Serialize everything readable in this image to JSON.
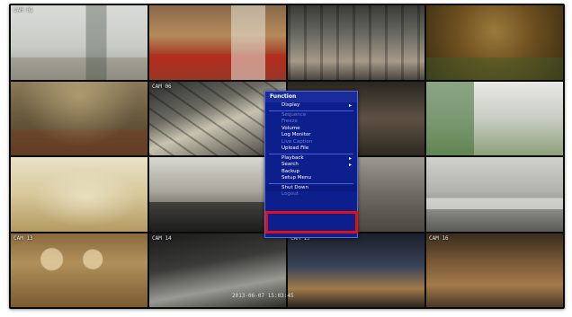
{
  "cameras": [
    {
      "label": "CAM 01"
    },
    {
      "label": ""
    },
    {
      "label": ""
    },
    {
      "label": ""
    },
    {
      "label": ""
    },
    {
      "label": "CAM 06"
    },
    {
      "label": ""
    },
    {
      "label": ""
    },
    {
      "label": ""
    },
    {
      "label": ""
    },
    {
      "label": ""
    },
    {
      "label": ""
    },
    {
      "label": "CAM 13"
    },
    {
      "label": "CAM 14"
    },
    {
      "label": "CAM 15"
    },
    {
      "label": "CAM 16"
    }
  ],
  "timestamp": "2013-06-07 15:03:45",
  "context_menu": {
    "title": "Function",
    "items": [
      {
        "label": "Display",
        "disabled": false,
        "submenu": true
      },
      {
        "label": "Sequence",
        "disabled": true,
        "submenu": false
      },
      {
        "label": "Freeze",
        "disabled": true,
        "submenu": false
      },
      {
        "label": "Volume",
        "disabled": false,
        "submenu": false
      },
      {
        "label": "Log Monitor",
        "disabled": false,
        "submenu": false
      },
      {
        "label": "Live Caption",
        "disabled": true,
        "submenu": false
      },
      {
        "label": "Upload File",
        "disabled": false,
        "submenu": false
      },
      {
        "label": "Playback",
        "disabled": false,
        "submenu": true
      },
      {
        "label": "Search",
        "disabled": false,
        "submenu": true
      },
      {
        "label": "Backup",
        "disabled": false,
        "submenu": false
      },
      {
        "label": "Setup Menu",
        "disabled": false,
        "submenu": false
      },
      {
        "label": "Shut Down",
        "disabled": false,
        "submenu": false,
        "highlighted": true
      },
      {
        "label": "Logout",
        "disabled": true,
        "submenu": false
      }
    ]
  },
  "colors": {
    "menu_bg": "#0d1f8c",
    "highlight_border": "#e0101a"
  }
}
